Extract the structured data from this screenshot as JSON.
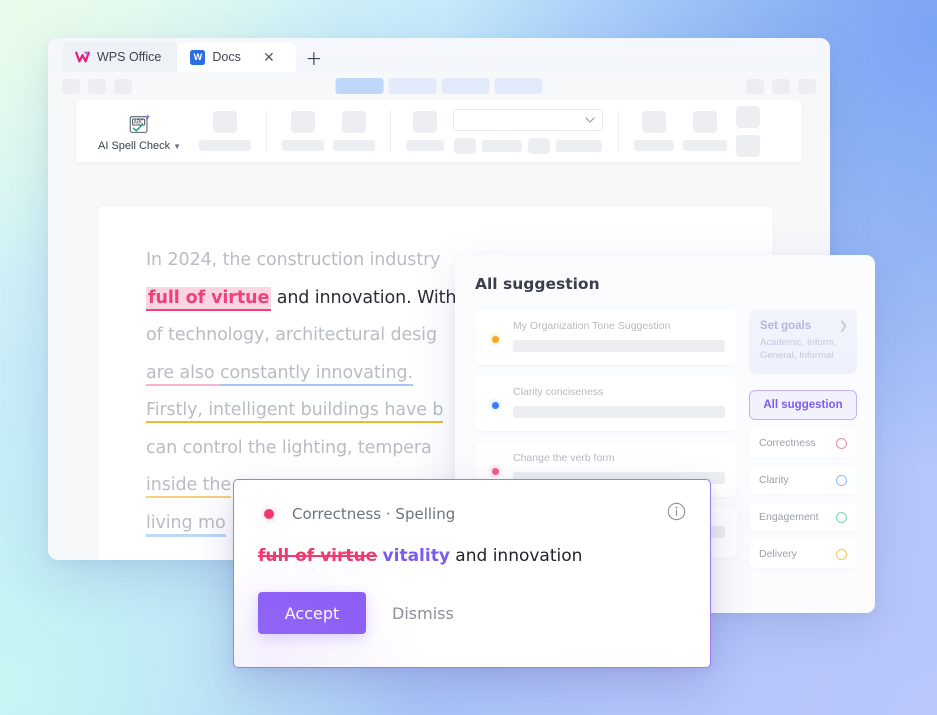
{
  "window": {
    "tabs": [
      {
        "label": "WPS Office",
        "icon": "wps-logo-icon",
        "active": false
      },
      {
        "label": "Docs",
        "icon": "docs-w-icon",
        "active": true
      }
    ],
    "close_label": "✕",
    "new_tab_label": "＋"
  },
  "toolbar": {
    "spell_check_label": "AI Spell Check",
    "spell_check_icon": "abc-spellcheck-icon",
    "caret_icon": "chevron-down-icon",
    "select_value": "",
    "select_caret_icon": "chevron-down-icon"
  },
  "document": {
    "lines": [
      {
        "id": "l1",
        "plain": "In 2024, the construction industry"
      },
      {
        "id": "l2",
        "highlight": "full of virtue",
        "rest": " and innovation. With"
      },
      {
        "id": "l3",
        "plain": "of technology, architectural desig"
      },
      {
        "id": "l4",
        "pink": "are also ",
        "blue": "constantly innovating."
      },
      {
        "id": "l5",
        "plain": "Firstly, intelligent buildings have b"
      },
      {
        "id": "l6",
        "plain": "can control the lighting, tempera"
      },
      {
        "id": "l7",
        "orange": "inside the"
      },
      {
        "id": "l8",
        "plain": "living mo"
      }
    ]
  },
  "suggestion_panel": {
    "title": "All suggestion",
    "cards": [
      {
        "label": "My  Organization Tone Suggestion",
        "dot": "orange"
      },
      {
        "label": "Clarity   conciseness",
        "dot": "blue"
      },
      {
        "label": "Change the verb form",
        "dot": "pink"
      },
      {
        "label": "",
        "dot": "pink"
      }
    ],
    "goals": {
      "title": "Set goals",
      "subtitle": "Academic, Inform, General, Informal",
      "chevron_icon": "chevron-right-icon"
    },
    "all_suggestion_button": "All suggestion",
    "categories": [
      {
        "label": "Correctness",
        "ring": "pink"
      },
      {
        "label": "Clarity",
        "ring": "blue"
      },
      {
        "label": "Engagement",
        "ring": "green"
      },
      {
        "label": "Delivery",
        "ring": "orange"
      }
    ]
  },
  "correction_popup": {
    "category": "Correctness · Spelling",
    "info_icon": "info-circle-icon",
    "original_text": "full of virtue",
    "replacement_text": "vitality",
    "trailing_text": " and innovation",
    "accept_label": "Accept",
    "dismiss_label": "Dismiss"
  },
  "colors": {
    "accent_purple": "#8b5cf6",
    "correctness_pink": "#f2386f",
    "highlight_bg": "#fbd6e2",
    "clarity_blue": "#3d7ff0",
    "delivery_orange": "#f6a623",
    "engagement_green": "#6fd9ba"
  }
}
